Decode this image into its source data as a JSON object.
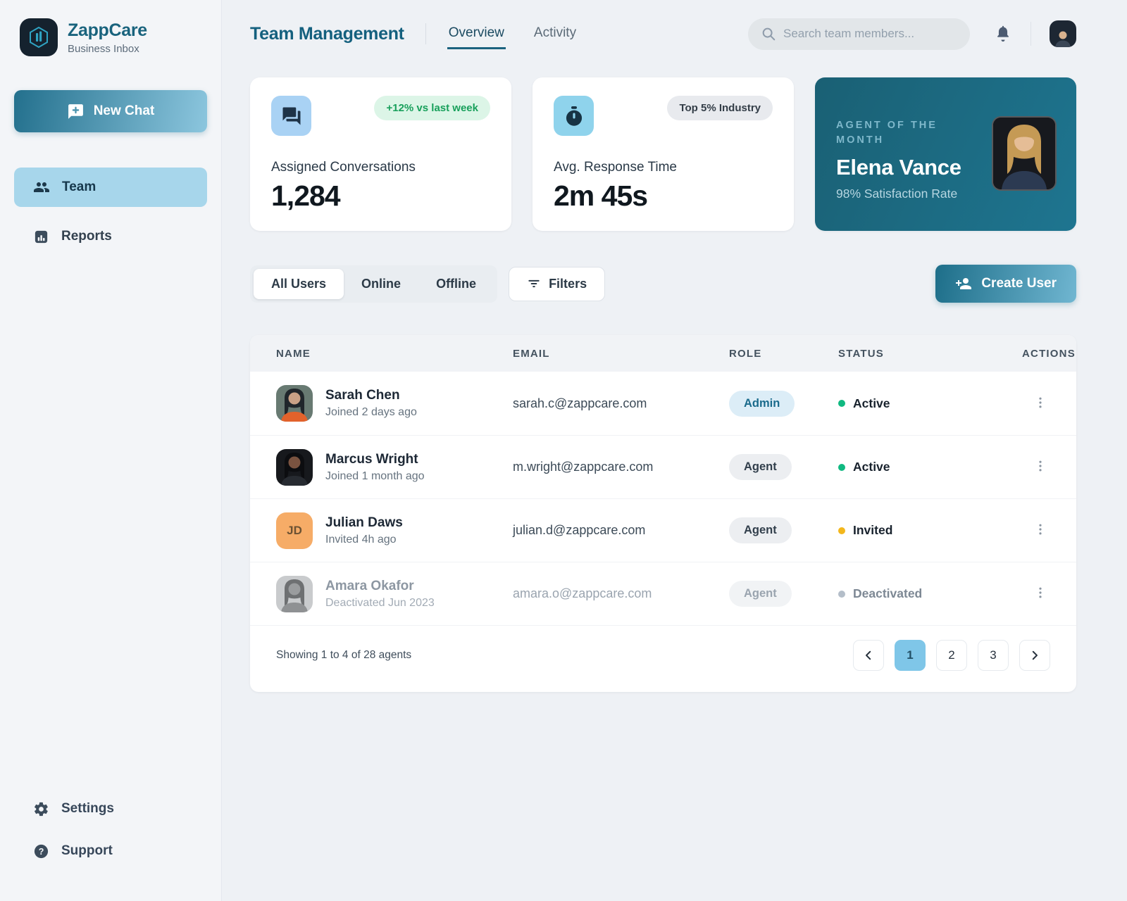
{
  "app": {
    "name": "ZappCare",
    "tagline": "Business Inbox"
  },
  "colors": {
    "accent_teal": "#19637d",
    "active_green": "#10b981",
    "invited_amber": "#f3b71c",
    "deactivated_gray": "#b4bec9",
    "positive_badge_bg": "#dcf5e7",
    "positive_badge_text": "#18a05b",
    "admin_pill_bg": "#dcedf7",
    "admin_pill_text": "#1a6b8c",
    "active_page_bg": "#7fc6e8"
  },
  "sidebar": {
    "new_chat_label": "New Chat",
    "items": [
      {
        "label": "Team",
        "icon": "people-icon",
        "active": true
      },
      {
        "label": "Reports",
        "icon": "chart-icon",
        "active": false
      }
    ],
    "footer_items": [
      {
        "label": "Settings",
        "icon": "gear-icon"
      },
      {
        "label": "Support",
        "icon": "help-icon"
      }
    ]
  },
  "header": {
    "title": "Team Management",
    "tabs": [
      {
        "label": "Overview",
        "active": true
      },
      {
        "label": "Activity",
        "active": false
      }
    ],
    "search_placeholder": "Search team members..."
  },
  "stats": [
    {
      "label": "Assigned Conversations",
      "value": "1,284",
      "badge": "+12% vs last week",
      "badge_type": "positive",
      "icon": "chat-bubbles-icon",
      "icon_bg": "#a9d2f4",
      "icon_color": "#1e3348"
    },
    {
      "label": "Avg. Response Time",
      "value": "2m 45s",
      "badge": "Top 5% Industry",
      "badge_type": "neutral",
      "icon": "stopwatch-icon",
      "icon_bg": "#8fd3ec",
      "icon_color": "#173344"
    }
  ],
  "agent_of_month": {
    "eyebrow": "AGENT OF THE MONTH",
    "name": "Elena Vance",
    "detail": "98% Satisfaction Rate"
  },
  "filters": {
    "segments": [
      {
        "label": "All Users",
        "active": true
      },
      {
        "label": "Online",
        "active": false
      },
      {
        "label": "Offline",
        "active": false
      }
    ],
    "filters_button_label": "Filters",
    "create_button_label": "Create User"
  },
  "table": {
    "columns": [
      "NAME",
      "EMAIL",
      "ROLE",
      "STATUS",
      "ACTIONS"
    ],
    "rows": [
      {
        "name": "Sarah Chen",
        "meta": "Joined 2 days ago",
        "email": "sarah.c@zappcare.com",
        "role": "Admin",
        "status": "Active",
        "status_type": "active",
        "deactivated": false,
        "avatar_type": "photo",
        "avatar_bg": "#687a72",
        "avatar_hair": "#20262b",
        "avatar_skin": "#c9a186",
        "avatar_shirt": "#e2622b"
      },
      {
        "name": "Marcus Wright",
        "meta": "Joined 1 month ago",
        "email": "m.wright@zappcare.com",
        "role": "Agent",
        "status": "Active",
        "status_type": "active",
        "deactivated": false,
        "avatar_type": "photo",
        "avatar_bg": "#17191d",
        "avatar_hair": "#0c0d10",
        "avatar_skin": "#7a5340",
        "avatar_shirt": "#272b31"
      },
      {
        "name": "Julian Daws",
        "meta": "Invited 4h ago",
        "email": "julian.d@zappcare.com",
        "role": "Agent",
        "status": "Invited",
        "status_type": "invited",
        "deactivated": false,
        "avatar_type": "initials",
        "avatar_initials": "JD",
        "avatar_bg": "#f6ac67"
      },
      {
        "name": "Amara Okafor",
        "meta": "Deactivated Jun 2023",
        "email": "amara.o@zappcare.com",
        "role": "Agent",
        "status": "Deactivated",
        "status_type": "deactivated",
        "deactivated": true,
        "avatar_type": "photo",
        "avatar_bg": "#c9cbcd",
        "avatar_hair": "#6e7072",
        "avatar_skin": "#9a9c9e",
        "avatar_shirt": "#8f9193"
      }
    ],
    "footer": {
      "summary": "Showing 1 to 4 of 28 agents",
      "pages": [
        "1",
        "2",
        "3"
      ],
      "active_page": "1"
    }
  }
}
